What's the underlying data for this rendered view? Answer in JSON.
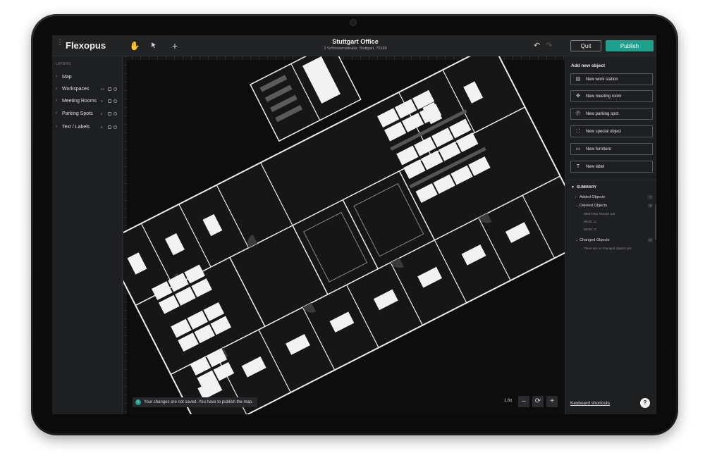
{
  "app": {
    "name": "Flexopus"
  },
  "header": {
    "title": "Stuttgart Office",
    "subtitle": "2 Schlossersstraße, Stuttgart, 70180",
    "quit_label": "Quit",
    "publish_label": "Publish"
  },
  "toolbar": {
    "tools": [
      "hand-icon",
      "pointer-icon",
      "plus-icon"
    ]
  },
  "layers": {
    "heading": "LAYERS",
    "items": [
      {
        "label": "Map",
        "count": ""
      },
      {
        "label": "Workspaces",
        "count": "24"
      },
      {
        "label": "Meeting Rooms",
        "count": "3"
      },
      {
        "label": "Parking Spots",
        "count": "2"
      },
      {
        "label": "Text / Labels",
        "count": "5"
      }
    ]
  },
  "add_panel": {
    "heading": "Add new object",
    "buttons": [
      {
        "label": "New work station",
        "icon": "workstation-icon"
      },
      {
        "label": "New meeting room",
        "icon": "meeting-room-icon"
      },
      {
        "label": "New parking spot",
        "icon": "parking-icon"
      },
      {
        "label": "New special object",
        "icon": "special-object-icon"
      },
      {
        "label": "New furniture",
        "icon": "furniture-icon"
      },
      {
        "label": "New label",
        "icon": "label-icon"
      }
    ]
  },
  "summary": {
    "heading": "SUMMARY",
    "added": {
      "label": "Added Objects",
      "count": "7"
    },
    "deleted": {
      "label": "Deleted Objects",
      "count": "3",
      "items": [
        "MEETING ROOM 126",
        "DESK 12",
        "DESK 11"
      ]
    },
    "changed": {
      "label": "Changed Objects",
      "count": "0",
      "note": "There are no changed objects yet."
    }
  },
  "status": {
    "message": "Your changes are not saved. You have to publish the map."
  },
  "zoom": {
    "level": "1.6x"
  },
  "footer": {
    "shortcuts": "Keyboard shortcuts"
  },
  "colors": {
    "accent": "#1f9f8e",
    "background": "#1e1f21",
    "canvas": "#0d0d0e"
  }
}
